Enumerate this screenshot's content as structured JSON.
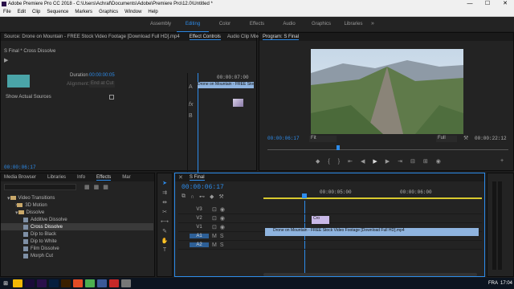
{
  "window": {
    "title": "Adobe Premiere Pro CC 2018 - C:\\Users\\Achraf\\Documents\\Adobe\\Premiere Pro\\12.0\\Untitled *",
    "min": "—",
    "max": "☐",
    "close": "✕"
  },
  "menu": [
    "File",
    "Edit",
    "Clip",
    "Sequence",
    "Markers",
    "Graphics",
    "Window",
    "Help"
  ],
  "workspaces": {
    "items": [
      "Assembly",
      "Editing",
      "Color",
      "Effects",
      "Audio",
      "Graphics",
      "Libraries"
    ],
    "active": "Editing"
  },
  "source": {
    "tabs": [
      "Source: Drone on Mountain - FREE Stock Video Footage [Download Full HD].mp4",
      "Effect Controls",
      "Audio Clip Mixer"
    ],
    "active": "Effect Controls",
    "clip_name": "S Final * Cross Dissolve",
    "duration_label": "Duration",
    "duration_value": "00:00:00:05",
    "alignment_label": "Alignment:",
    "alignment_value": "End at Cut",
    "show_sources": "Show Actual Sources",
    "ruler_time": "00:00:07:00",
    "clip_bar": "Drone on Mountain - FREE Stock",
    "fx_a": "A",
    "fx_b": "B",
    "timecode": "00:00:06:17"
  },
  "program": {
    "tab": "Program: S Final",
    "timecode": "00:00:06:17",
    "fit": "Fit",
    "quality": "Full",
    "duration": "00:00:22:12"
  },
  "project": {
    "tabs": [
      "Media Browser",
      "Libraries",
      "Info",
      "Effects",
      "Mar"
    ],
    "active": "Effects",
    "tree": [
      {
        "label": "Video Transitions",
        "type": "folder",
        "indent": 0
      },
      {
        "label": "3D Motion",
        "type": "folder",
        "indent": 1
      },
      {
        "label": "Dissolve",
        "type": "folder",
        "indent": 1
      },
      {
        "label": "Additive Dissolve",
        "type": "fx",
        "indent": 2
      },
      {
        "label": "Cross Dissolve",
        "type": "fx",
        "indent": 2,
        "selected": true
      },
      {
        "label": "Dip to Black",
        "type": "fx",
        "indent": 2
      },
      {
        "label": "Dip to White",
        "type": "fx",
        "indent": 2
      },
      {
        "label": "Film Dissolve",
        "type": "fx",
        "indent": 2
      },
      {
        "label": "Morph Cut",
        "type": "fx",
        "indent": 2
      }
    ]
  },
  "timeline": {
    "tab": "S Final",
    "timecode": "00:00:06:17",
    "ruler": [
      "00:00:05:00",
      "00:00:06:00"
    ],
    "tracks": [
      "V3",
      "V2",
      "V1",
      "A1",
      "A2"
    ],
    "clip_v1": "Drone on Mountain - FREE Stock Video Footage [Download Full HD].mp4",
    "clip_v2": "Cro"
  },
  "taskbar": {
    "lang": "FRA",
    "time": "17:04"
  },
  "colors": {
    "accent": "#2d8ceb",
    "clip": "#8fb4df"
  }
}
